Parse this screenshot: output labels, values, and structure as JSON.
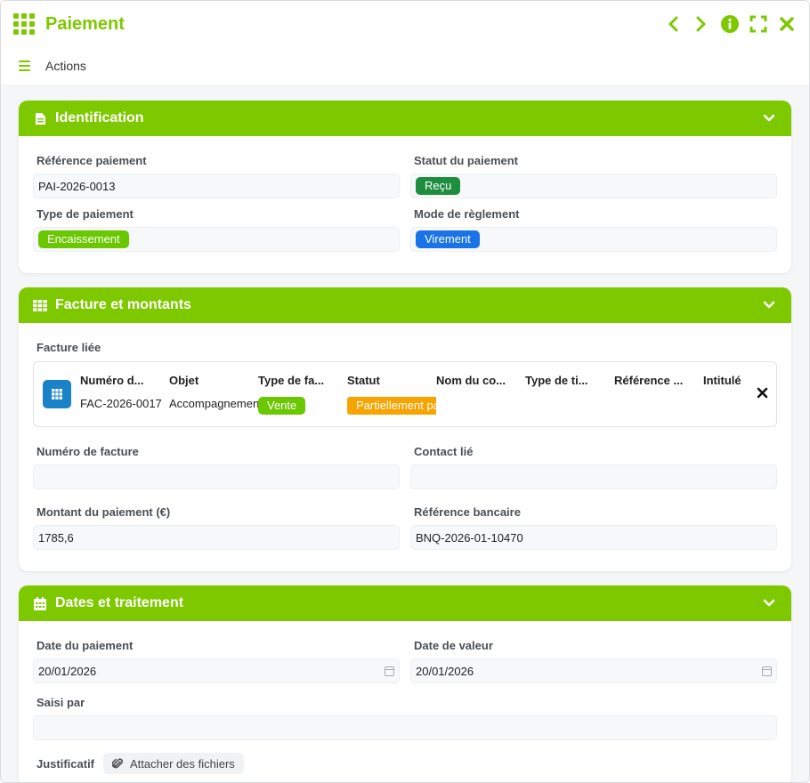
{
  "window": {
    "title": "Paiement"
  },
  "menu": {
    "actions_label": "Actions"
  },
  "colors": {
    "accent": "#7ec800",
    "recu": "#1e8e3e",
    "encaissement": "#6ac700",
    "virement": "#1a73e8",
    "vente": "#6ac700",
    "partiel": "#f7a400"
  },
  "identification": {
    "title": "Identification",
    "reference_label": "Référence paiement",
    "reference_value": "PAI-2026-0013",
    "statut_label": "Statut du paiement",
    "statut_value": "Reçu",
    "type_label": "Type de paiement",
    "type_value": "Encaissement",
    "mode_label": "Mode de règlement",
    "mode_value": "Virement"
  },
  "facture": {
    "title": "Facture et montants",
    "linked_label": "Facture liée",
    "columns": [
      "Numéro de facture",
      "Objet",
      "Type de facture",
      "Statut",
      "Nom du contact",
      "Type de tiers",
      "Référence bancaire",
      "Intitulé"
    ],
    "columns_display": [
      "Numéro d...",
      "Objet",
      "Type de fa...",
      "Statut",
      "Nom du co...",
      "Type de ti...",
      "Référence ...",
      "Intitulé"
    ],
    "row": {
      "numero": "FAC-2026-0017",
      "objet": "Accompagnement",
      "type": "Vente",
      "statut": "Partiellement payée"
    },
    "numero_label": "Numéro de facture",
    "numero_value": "",
    "contact_label": "Contact lié",
    "contact_value": "",
    "montant_label": "Montant du paiement (€)",
    "montant_value": "1785,6",
    "refbank_label": "Référence bancaire",
    "refbank_value": "BNQ-2026-01-10470"
  },
  "dates": {
    "title": "Dates et traitement",
    "date_paiement_label": "Date du paiement",
    "date_paiement_value": "20/01/2026",
    "date_valeur_label": "Date de valeur",
    "date_valeur_value": "20/01/2026",
    "saisi_label": "Saisi par",
    "saisi_value": "",
    "justif_label": "Justificatif",
    "attach_label": "Attacher des fichiers"
  }
}
